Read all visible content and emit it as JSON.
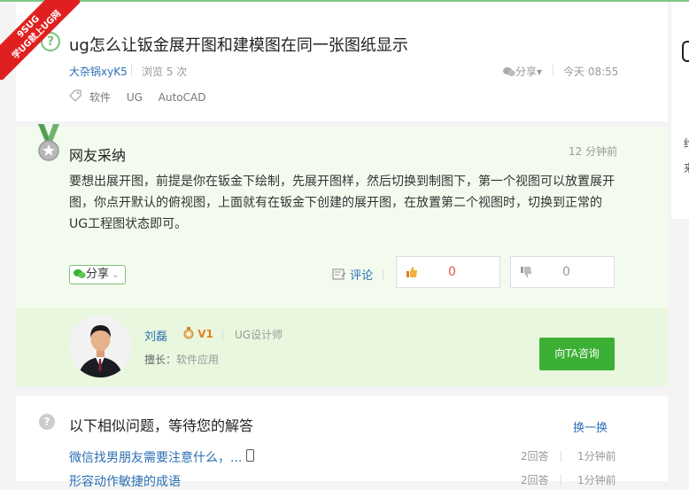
{
  "ribbon": {
    "line1": "9SUG",
    "line2": "学UG就上UG网"
  },
  "question": {
    "title": "ug怎么让钣金展开图和建模图在同一张图纸显示",
    "author": "大杂锅xyK5",
    "views": "浏览 5 次",
    "share": "分享▾",
    "time": "今天 08:55",
    "tags": [
      "软件",
      "UG",
      "AutoCAD"
    ]
  },
  "answer": {
    "title": "网友采纳",
    "time": "12 分钟前",
    "body": "要想出展开图，前提是你在钣金下绘制，先展开图样，然后切换到制图下，第一个视图可以放置展开图，你点开默认的俯视图，上面就有在钣金下创建的展开图，在放置第二个视图时，切换到正常的UG工程图状态即可。",
    "share_label": "分享",
    "comment_label": "评论",
    "upvotes": "0",
    "downvotes": "0"
  },
  "profile": {
    "name": "刘磊",
    "level": "V1",
    "role": "UG设计师",
    "skill_label": "擅长：",
    "skill_value": "软件应用",
    "consult_label": "向TA咨询"
  },
  "similar": {
    "title": "以下相似问题，等待您的解答",
    "swap_label": "换一换",
    "items": [
      {
        "question": "微信找男朋友需要注意什么，...",
        "answers": "2回答",
        "ago": "1分钟前"
      },
      {
        "question": "形容动作敏捷的成语",
        "answers": "2回答",
        "ago": "1分钟前"
      }
    ]
  },
  "sidebar": {
    "line1": "约",
    "line2": "来"
  },
  "colors": {
    "accent_green": "#3cb034",
    "link_blue": "#2b6fb3",
    "answer_bg": "#f3fbee",
    "profile_bg": "#e9f7de",
    "ribbon_red": "#e02020"
  }
}
